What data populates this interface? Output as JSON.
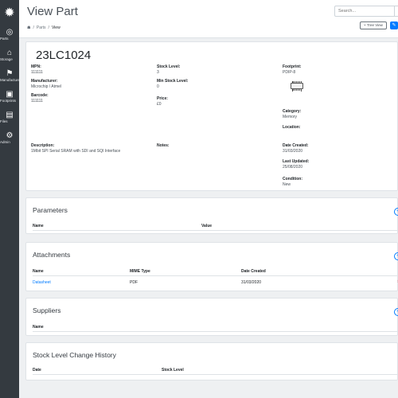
{
  "sidebar": {
    "items": [
      {
        "icon": "gauge-icon",
        "label": "Parts"
      },
      {
        "icon": "warehouse-icon",
        "label": "Storage"
      },
      {
        "icon": "factory-icon",
        "label": "Manufacturers"
      },
      {
        "icon": "blueprint-icon",
        "label": "Footprints"
      },
      {
        "icon": "file-icon",
        "label": "Files"
      },
      {
        "icon": "gear-icon",
        "label": "Admin"
      }
    ]
  },
  "header": {
    "title": "View Part",
    "search_placeholder": "Search...",
    "breadcrumb": [
      "Parts",
      "View"
    ],
    "tree_view_label": "Tree View"
  },
  "part": {
    "number": "23LC1024",
    "mpn_label": "MPN:",
    "mpn": "111111",
    "manufacturer_label": "Manufacturer:",
    "manufacturer": "Microchip / Atmel",
    "barcode_label": "Barcode:",
    "barcode": "111111",
    "stock_label": "Stock Level:",
    "stock": "3",
    "min_stock_label": "Min Stock Level:",
    "min_stock": "0",
    "price_label": "Price:",
    "price": "£0",
    "footprint_label": "Footprint:",
    "footprint": "PDIP-8",
    "category_label": "Category:",
    "category": "Memory",
    "location_label": "Location:",
    "location": "",
    "description_label": "Description:",
    "description": "1Mbit SPI Serial SRAM with SDI and SQI Interface",
    "notes_label": "Notes:",
    "notes": "",
    "date_created_label": "Date Created:",
    "date_created": "31/03/2020",
    "last_updated_label": "Last Updated:",
    "last_updated": "25/08/2020",
    "condition_label": "Condition:",
    "condition": "New"
  },
  "parameters": {
    "title": "Parameters",
    "columns": [
      "Name",
      "Value"
    ]
  },
  "attachments": {
    "title": "Attachments",
    "columns": [
      "Name",
      "MIME Type",
      "Date Created"
    ],
    "rows": [
      {
        "name": "Datasheet",
        "mime": "PDF",
        "date": "31/03/2020"
      }
    ]
  },
  "suppliers": {
    "title": "Suppliers",
    "columns": [
      "Name"
    ]
  },
  "stock_history": {
    "title": "Stock Level Change History",
    "columns": [
      "Date",
      "Stock Level"
    ]
  },
  "colors": {
    "sidebar": "#343a40",
    "accent": "#007bff",
    "danger": "#dc3545"
  }
}
